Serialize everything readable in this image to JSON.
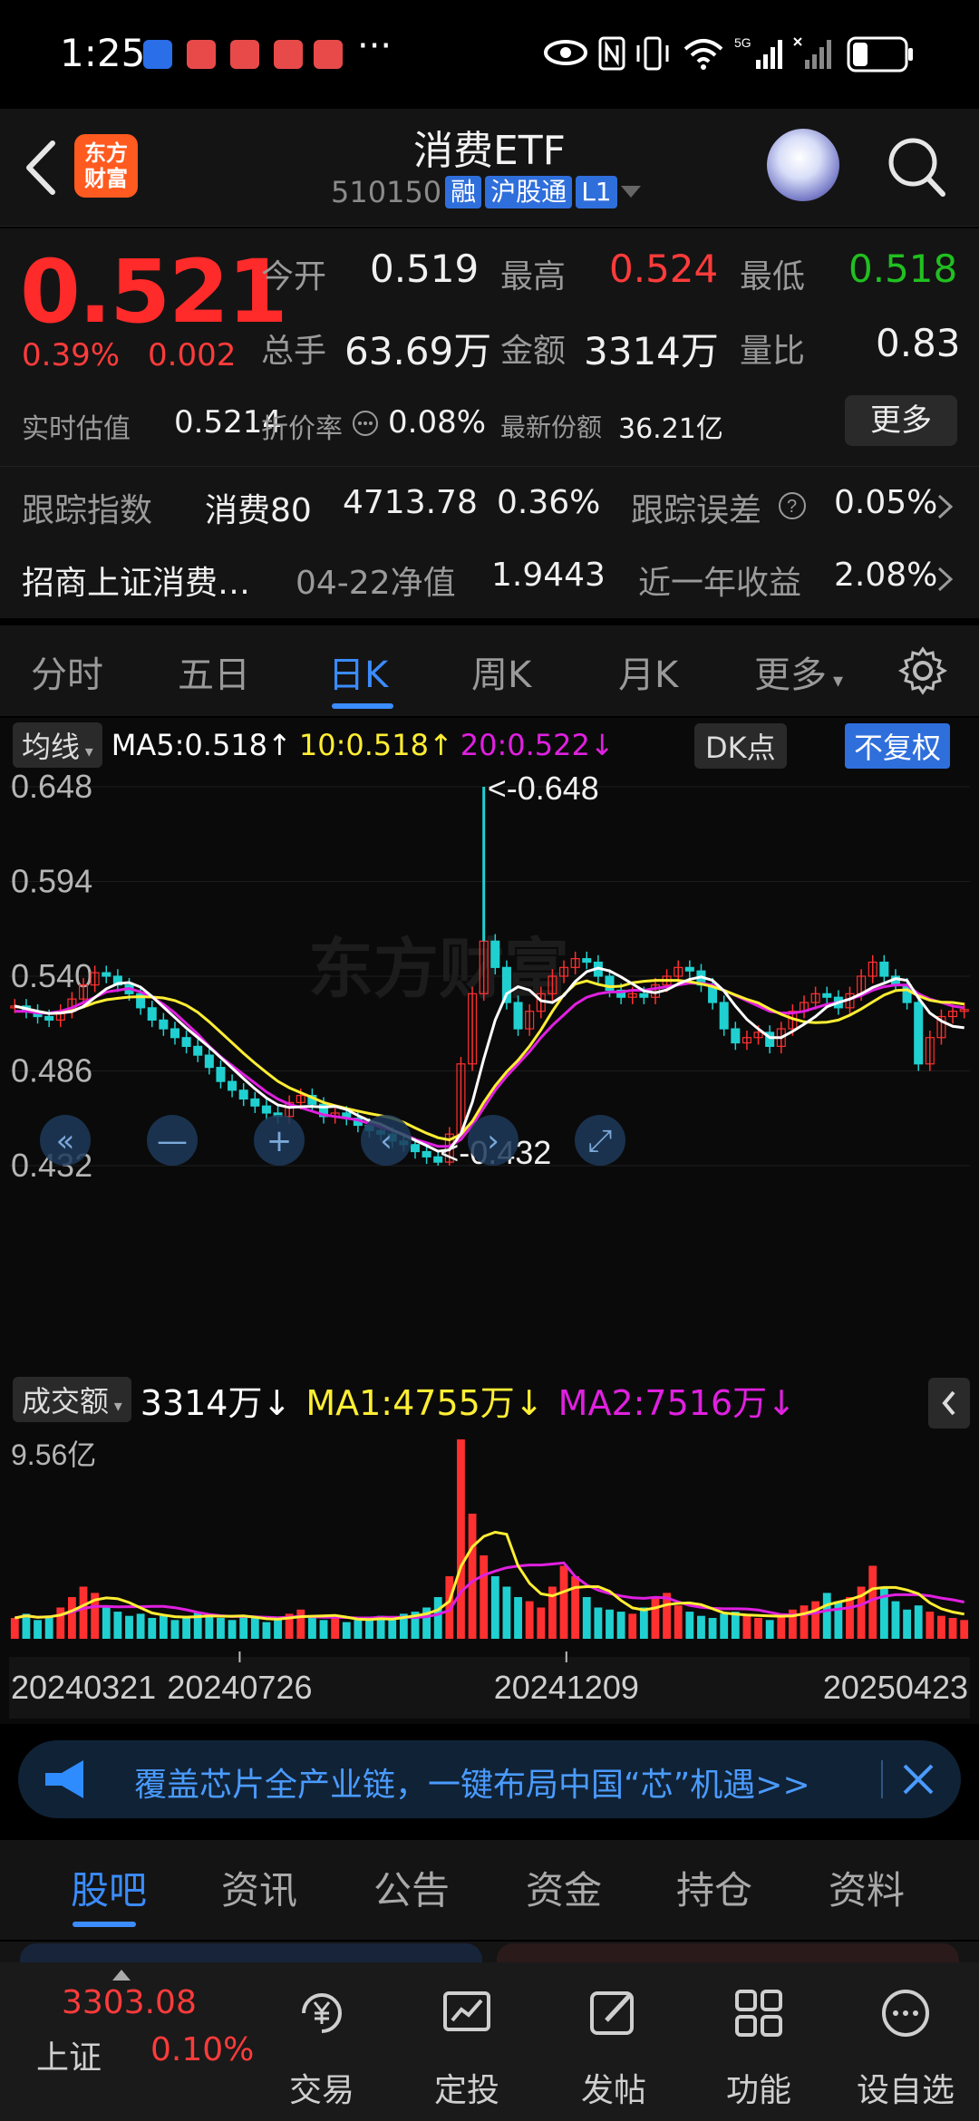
{
  "status_bar": {
    "time": "1:25",
    "more": "···"
  },
  "header": {
    "title": "消费ETF",
    "code": "510150",
    "tags": [
      "融",
      "沪股通",
      "L1"
    ],
    "logo_text": "东方财富"
  },
  "quote": {
    "price": "0.521",
    "change_pct": "0.39%",
    "change": "0.002",
    "open_label": "今开",
    "open": "0.519",
    "high_label": "最高",
    "high": "0.524",
    "low_label": "最低",
    "low": "0.518",
    "volume_label": "总手",
    "volume": "63.69万",
    "amount_label": "金额",
    "amount": "3314万",
    "ratio_label": "量比",
    "ratio": "0.83",
    "iopv_label": "实时估值",
    "iopv": "0.5214",
    "premium_label": "折价率",
    "premium": "0.08%",
    "shares_label": "最新份额",
    "shares": "36.21亿",
    "more_label": "更多"
  },
  "tracking": {
    "index_label": "跟踪指数",
    "index_name": "消费80",
    "index_value": "4713.78",
    "index_change": "0.36%",
    "error_label": "跟踪误差",
    "error_value": "0.05%",
    "fund_name": "招商上证消费…",
    "nav_label": "04-22净值",
    "nav_value": "1.9443",
    "yield_label": "近一年收益",
    "yield_value": "2.08%"
  },
  "tabs": [
    "分时",
    "五日",
    "日K",
    "周K",
    "月K",
    "更多"
  ],
  "active_tab": "日K",
  "chart_controls": {
    "ma_select": "均线",
    "ma5": "MA5:0.518↑",
    "ma10": "10:0.518↑",
    "ma20": "20:0.522↓",
    "dk_label": "DK点",
    "adjust_label": "不复权",
    "vol_select": "成交额",
    "vol_value": "3314万↓",
    "vol_ma1": "MA1:4755万↓",
    "vol_ma2": "MA2:7516万↓"
  },
  "chart_data": {
    "type": "line",
    "y_ticks": [
      "0.648",
      "0.594",
      "0.540",
      "0.486",
      "0.432"
    ],
    "ylim": [
      0.432,
      0.648
    ],
    "high_annotation": "<-0.648",
    "low_annotation": "<-0.432",
    "volume_max_label": "9.56亿",
    "x_ticks": [
      "20240321",
      "20240726",
      "20241209",
      "20250423"
    ],
    "watermark": "东方财富",
    "colors": {
      "up": "#ff3030",
      "down": "#20d0d0",
      "ma5": "#ffffff",
      "ma10": "#ffee33",
      "ma20": "#e020e0"
    },
    "close": [
      0.523,
      0.52,
      0.517,
      0.515,
      0.52,
      0.527,
      0.535,
      0.542,
      0.54,
      0.535,
      0.53,
      0.522,
      0.515,
      0.51,
      0.505,
      0.5,
      0.495,
      0.488,
      0.48,
      0.475,
      0.47,
      0.466,
      0.462,
      0.46,
      0.468,
      0.472,
      0.467,
      0.46,
      0.462,
      0.459,
      0.455,
      0.452,
      0.45,
      0.446,
      0.444,
      0.44,
      0.437,
      0.434,
      0.45,
      0.49,
      0.53,
      0.56,
      0.545,
      0.525,
      0.51,
      0.52,
      0.53,
      0.54,
      0.545,
      0.55,
      0.548,
      0.54,
      0.532,
      0.528,
      0.53,
      0.528,
      0.535,
      0.54,
      0.545,
      0.543,
      0.535,
      0.525,
      0.51,
      0.502,
      0.505,
      0.508,
      0.5,
      0.51,
      0.52,
      0.525,
      0.53,
      0.528,
      0.522,
      0.53,
      0.54,
      0.548,
      0.54,
      0.535,
      0.525,
      0.49,
      0.505,
      0.517,
      0.52,
      0.521
    ],
    "ma20": [
      0.52,
      0.52,
      0.519,
      0.519,
      0.52,
      0.522,
      0.525,
      0.528,
      0.531,
      0.532,
      0.533,
      0.531,
      0.528,
      0.524,
      0.519,
      0.513,
      0.507,
      0.5,
      0.494,
      0.489,
      0.484,
      0.479,
      0.474,
      0.47,
      0.467,
      0.465,
      0.463,
      0.461,
      0.46,
      0.459,
      0.458,
      0.456,
      0.454,
      0.452,
      0.45,
      0.447,
      0.445,
      0.443,
      0.443,
      0.447,
      0.455,
      0.465,
      0.475,
      0.483,
      0.49,
      0.497,
      0.505,
      0.512,
      0.518,
      0.524,
      0.528,
      0.53,
      0.531,
      0.531,
      0.532,
      0.532,
      0.533,
      0.534,
      0.535,
      0.536,
      0.536,
      0.535,
      0.532,
      0.529,
      0.526,
      0.523,
      0.52,
      0.519,
      0.519,
      0.52,
      0.522,
      0.524,
      0.525,
      0.527,
      0.529,
      0.532,
      0.534,
      0.535,
      0.535,
      0.53,
      0.527,
      0.525,
      0.523,
      0.522
    ],
    "volume": [
      1,
      1.2,
      0.9,
      1.1,
      1.5,
      2,
      2.5,
      2.2,
      1.6,
      1.3,
      1.1,
      1.2,
      1,
      1.1,
      0.9,
      1,
      1.3,
      1.2,
      1,
      0.9,
      1.1,
      1,
      0.8,
      0.9,
      1.2,
      1.4,
      1.1,
      0.9,
      1,
      0.8,
      0.9,
      1,
      1.1,
      0.9,
      1.2,
      1.3,
      1.5,
      2,
      3,
      9.56,
      6,
      4,
      3,
      2.5,
      2,
      1.8,
      1.5,
      2.5,
      3.5,
      3,
      2,
      1.5,
      1.4,
      1.3,
      1.2,
      1.5,
      2,
      2.2,
      1.6,
      1.3,
      1.1,
      1,
      1.2,
      1.3,
      1.1,
      1,
      0.9,
      1.1,
      1.4,
      1.6,
      1.8,
      2.2,
      1.8,
      2,
      2.5,
      3.5,
      2.5,
      1.8,
      1.4,
      1.6,
      1.3,
      1.1,
      1,
      0.9
    ]
  },
  "ad": {
    "text": "覆盖芯片全产业链，一键布局中国“芯”机遇>>"
  },
  "bottom_tabs": [
    "股吧",
    "资讯",
    "公告",
    "资金",
    "持仓",
    "资料"
  ],
  "index_bar": {
    "value": "3303.08",
    "name": "上证",
    "change": "0.10%"
  },
  "nav": [
    "交易",
    "定投",
    "发帖",
    "功能",
    "设自选"
  ]
}
